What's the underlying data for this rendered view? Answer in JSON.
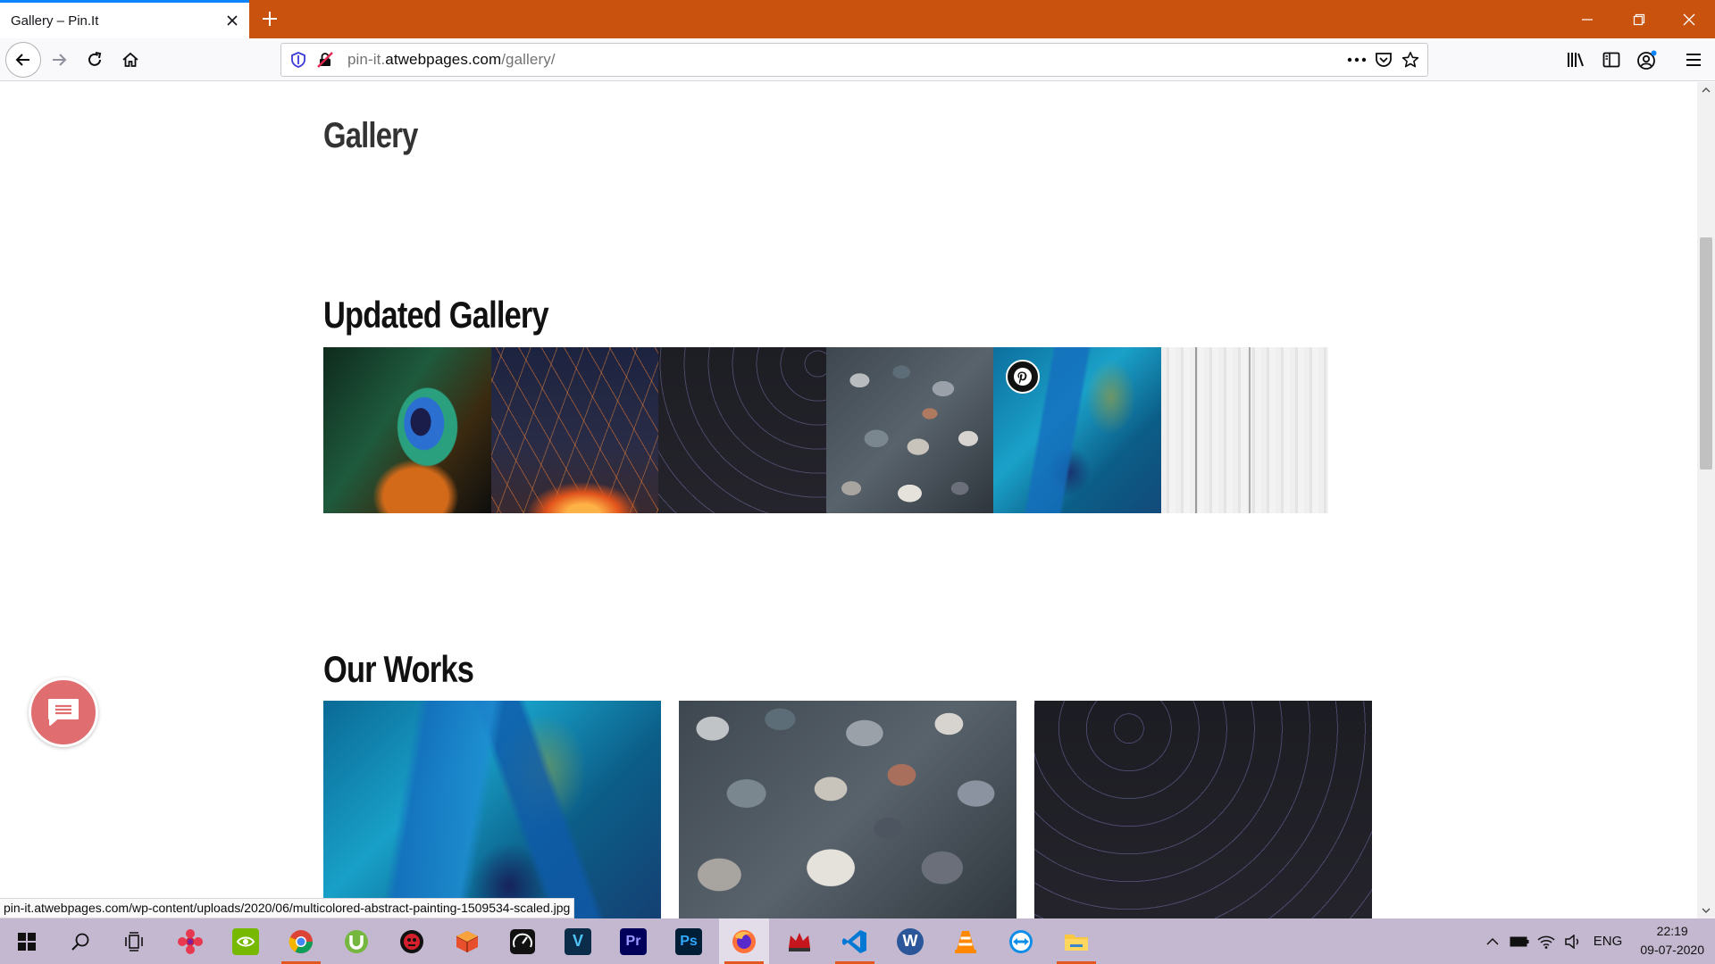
{
  "browser": {
    "tab_title": "Gallery – Pin.It",
    "url_prefix": "pin-it.",
    "url_domain": "atwebpages.com",
    "url_path": "/gallery/",
    "status_link": "pin-it.atwebpages.com/wp-content/uploads/2020/06/multicolored-abstract-painting-1509534-scaled.jpg",
    "accent_color": "#c9520f"
  },
  "page": {
    "title": "Gallery",
    "updated_gallery_heading": "Updated Gallery",
    "our_works_heading": "Our Works",
    "updated_gallery_images": [
      {
        "name": "peacock-feather-image"
      },
      {
        "name": "fire-sparks-image"
      },
      {
        "name": "star-trails-image"
      },
      {
        "name": "pebbles-image"
      },
      {
        "name": "blue-abstract-painting-image"
      },
      {
        "name": "white-wood-image"
      }
    ],
    "our_works_images": [
      {
        "name": "blue-abstract-painting-image"
      },
      {
        "name": "pebbles-image"
      },
      {
        "name": "star-trails-image"
      }
    ],
    "chat_button_color": "#e06e71"
  },
  "taskbar": {
    "apps": [
      "start-icon",
      "search-icon",
      "task-view-icon",
      "app-red-flower-icon",
      "nvidia-icon",
      "chrome-icon",
      "utorrent-icon",
      "app-red-skull-icon",
      "app-box-icon",
      "speedometer-icon",
      "vegas-icon",
      "premiere-icon",
      "photoshop-icon",
      "firefox-icon",
      "app-red-crown-icon",
      "vscode-icon",
      "word-icon",
      "vlc-icon",
      "teamviewer-icon",
      "file-explorer-icon"
    ],
    "premiere_label": "Pr",
    "photoshop_label": "Ps",
    "vegas_label": "V",
    "word_label": "W",
    "language": "ENG",
    "time": "22:19",
    "date": "09-07-2020"
  }
}
